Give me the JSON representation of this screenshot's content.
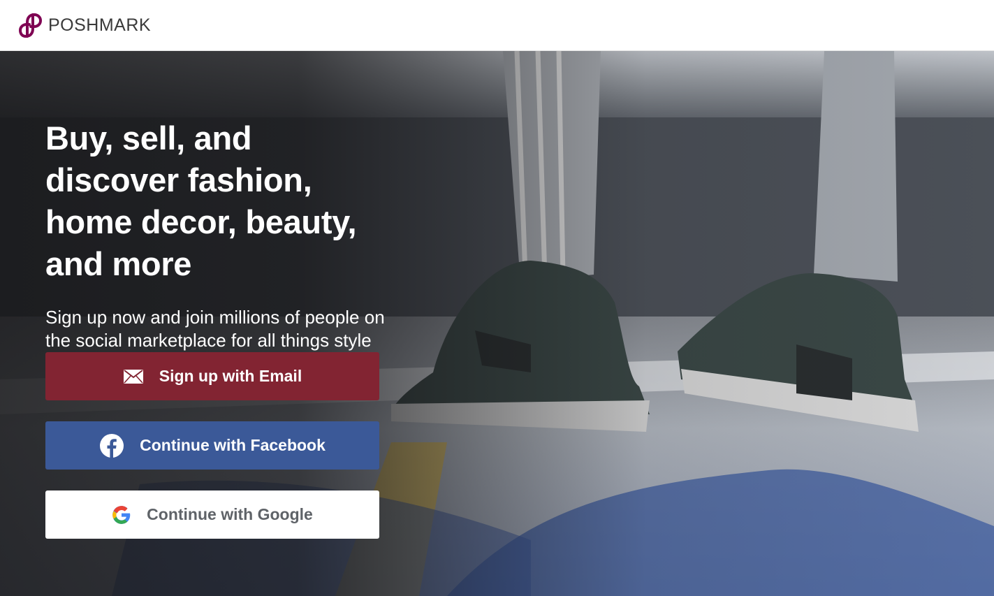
{
  "brand": {
    "name": "POSHMARK",
    "logo_color": "#7f0353"
  },
  "hero": {
    "headline": "Buy, sell, and discover fashion, home decor, beauty, and more",
    "subtext": "Sign up now and join millions of people on the social marketplace for all things style"
  },
  "buttons": {
    "email": {
      "label": "Sign up with Email",
      "icon": "envelope-icon",
      "color": "#822432"
    },
    "facebook": {
      "label": "Continue with Facebook",
      "icon": "facebook-icon",
      "color": "#3b5998"
    },
    "google": {
      "label": "Continue with Google",
      "icon": "google-icon",
      "color": "#ffffff"
    }
  }
}
